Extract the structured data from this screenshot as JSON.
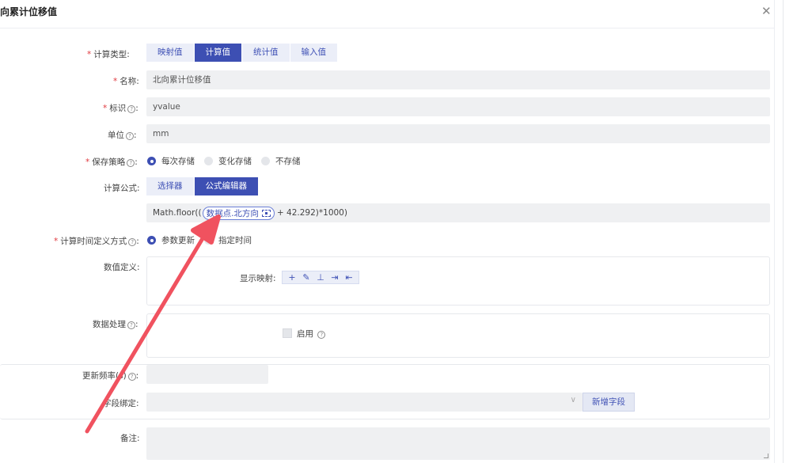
{
  "dialog": {
    "title": "向累计位移值",
    "close_icon": "close-icon"
  },
  "calc_type": {
    "label": "计算类型:",
    "options": [
      "映射值",
      "计算值",
      "统计值",
      "输入值"
    ],
    "selected": "计算值"
  },
  "name": {
    "label": "名称:",
    "value": "北向累计位移值"
  },
  "identifier": {
    "label": "标识",
    "colon": ":",
    "value": "yvalue"
  },
  "unit": {
    "label": "单位",
    "colon": ":",
    "value": "mm"
  },
  "save_policy": {
    "label": "保存策略",
    "colon": ":",
    "options": [
      "每次存储",
      "变化存储",
      "不存储"
    ],
    "selected": "每次存储"
  },
  "formula": {
    "label": "计算公式:",
    "tabs": [
      "选择器",
      "公式编辑器"
    ],
    "selected": "公式编辑器",
    "prefix": "Math.floor((",
    "chip": "数据点.北方向",
    "suffix": "+ 42.292)*1000)"
  },
  "time_mode": {
    "label": "计算时间定义方式",
    "colon": ":",
    "options": [
      "参数更新",
      "指定时间"
    ],
    "selected": "参数更新"
  },
  "value_def": {
    "label": "数值定义:",
    "mapping_label": "显示映射:",
    "icons": [
      "plus-icon",
      "edit-icon",
      "stamp-icon",
      "import-icon",
      "export-icon"
    ]
  },
  "data_process": {
    "label": "数据处理",
    "colon": ":",
    "enable_label": "启用"
  },
  "update_rate": {
    "label": "更新频率",
    "suffix": "(s)",
    "colon": ":",
    "value": ""
  },
  "field_bind": {
    "label": "字段绑定:",
    "add_button": "新增字段",
    "value": ""
  },
  "remark": {
    "label": "备注:",
    "value": ""
  },
  "colors": {
    "primary": "#3d4fb3",
    "required": "#e0383e",
    "arrow": "#f0525f"
  }
}
